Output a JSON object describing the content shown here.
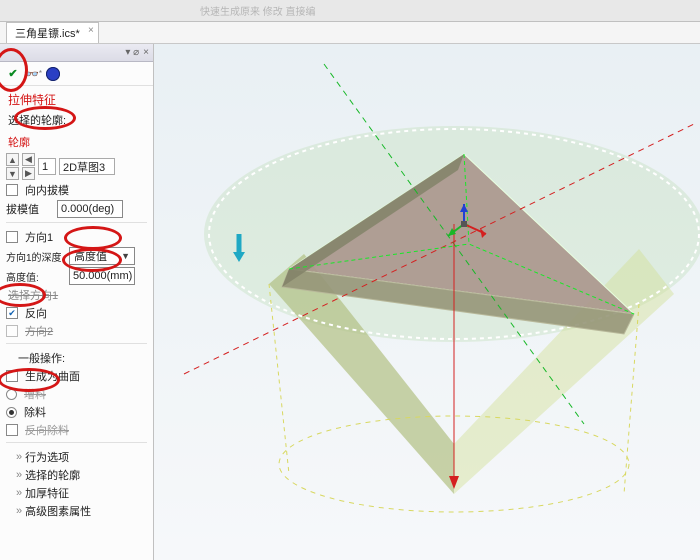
{
  "ribbonHints": "快速生成原来                          修改                          直接编",
  "docTab": "三角星镖.ics*",
  "sideHeader": {
    "pin": "▾ ⌀",
    "close": "×"
  },
  "feature": {
    "title": "拉伸特征",
    "selectedProfileLabel": "选择的轮廓:",
    "profileSection": "轮廓",
    "countValue": "1",
    "sketchName": "2D草图3",
    "draftInwardLabel": "向内拔模",
    "draftValueLabel": "拔模值",
    "draftValue": "0.000(deg)",
    "dir1": "方向1",
    "depthType1Label": "方向1的深度",
    "depthTypeValue": "高度值",
    "heightLabel": "高度值:",
    "heightValue": "50.000(mm)",
    "selectDir1": "选择方向1",
    "reverse": "反向",
    "dir2": "方向2",
    "generalOps": "一般操作:",
    "genSurface": "生成为曲面",
    "addMaterial": "增料",
    "removeMaterial": "除料",
    "reverseRemove": "反向除料",
    "behavior": "行为选项",
    "selProfiles": "选择的轮廓",
    "thicken": "加厚特征",
    "advanced": "高级图素属性"
  },
  "glyphs": {
    "up": "▲",
    "down": "▼",
    "left": "◀",
    "right": "▶",
    "check": "✔",
    "caret": "▼",
    "chev": "»"
  }
}
